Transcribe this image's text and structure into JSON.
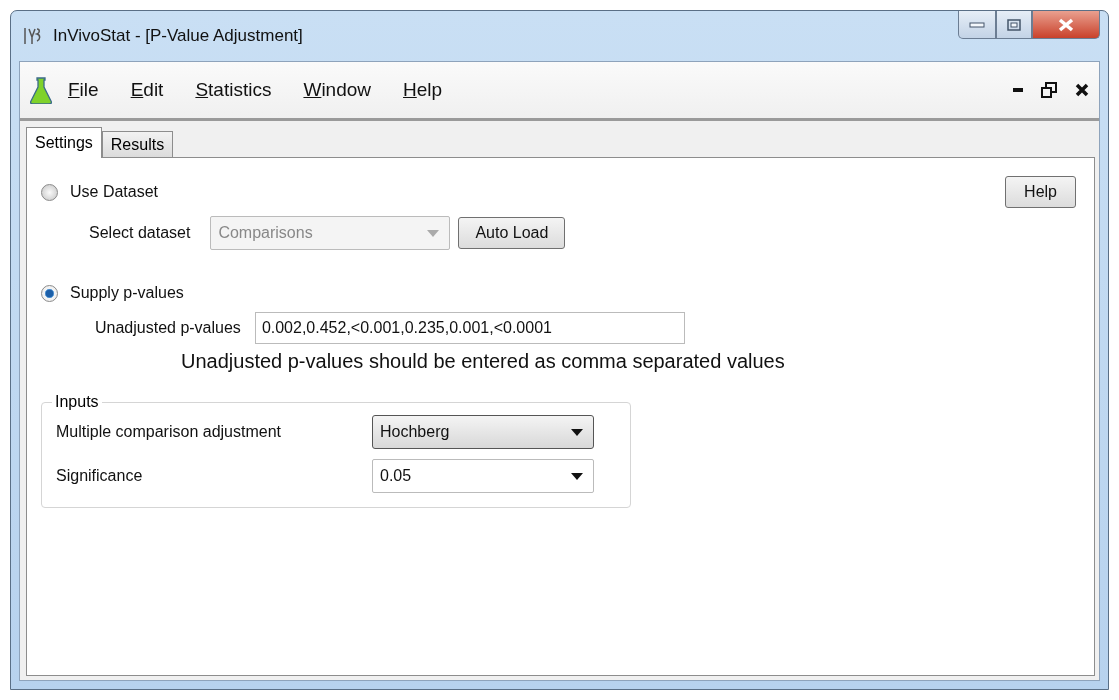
{
  "window": {
    "title": "InVivoStat - [P-Value Adjustment]"
  },
  "menu": [
    {
      "label": "File"
    },
    {
      "label": "Edit"
    },
    {
      "label": "Statistics"
    },
    {
      "label": "Window"
    },
    {
      "label": "Help"
    }
  ],
  "tabs": [
    {
      "label": "Settings",
      "selected": true
    },
    {
      "label": "Results",
      "selected": false
    }
  ],
  "source": [
    {
      "label": "Use Dataset",
      "selected": false
    },
    {
      "label": "Supply p-values",
      "selected": true
    }
  ],
  "help_button": "Help",
  "dataset": {
    "label": "Select dataset",
    "value": "Comparisons",
    "disabled": true,
    "button": "Auto Load"
  },
  "pvalues": {
    "label": "Unadjusted p-values",
    "value": "0.002,0.452,<0.001,0.235,0.001,<0.0001",
    "hint": "Unadjusted p-values should be entered as comma separated values"
  },
  "inputs": {
    "title": "Inputs",
    "rows": [
      {
        "label": "Multiple comparison adjustment",
        "value": "Hochberg",
        "kind": "button"
      },
      {
        "label": "Significance",
        "value": "0.05",
        "kind": "editable"
      }
    ]
  }
}
